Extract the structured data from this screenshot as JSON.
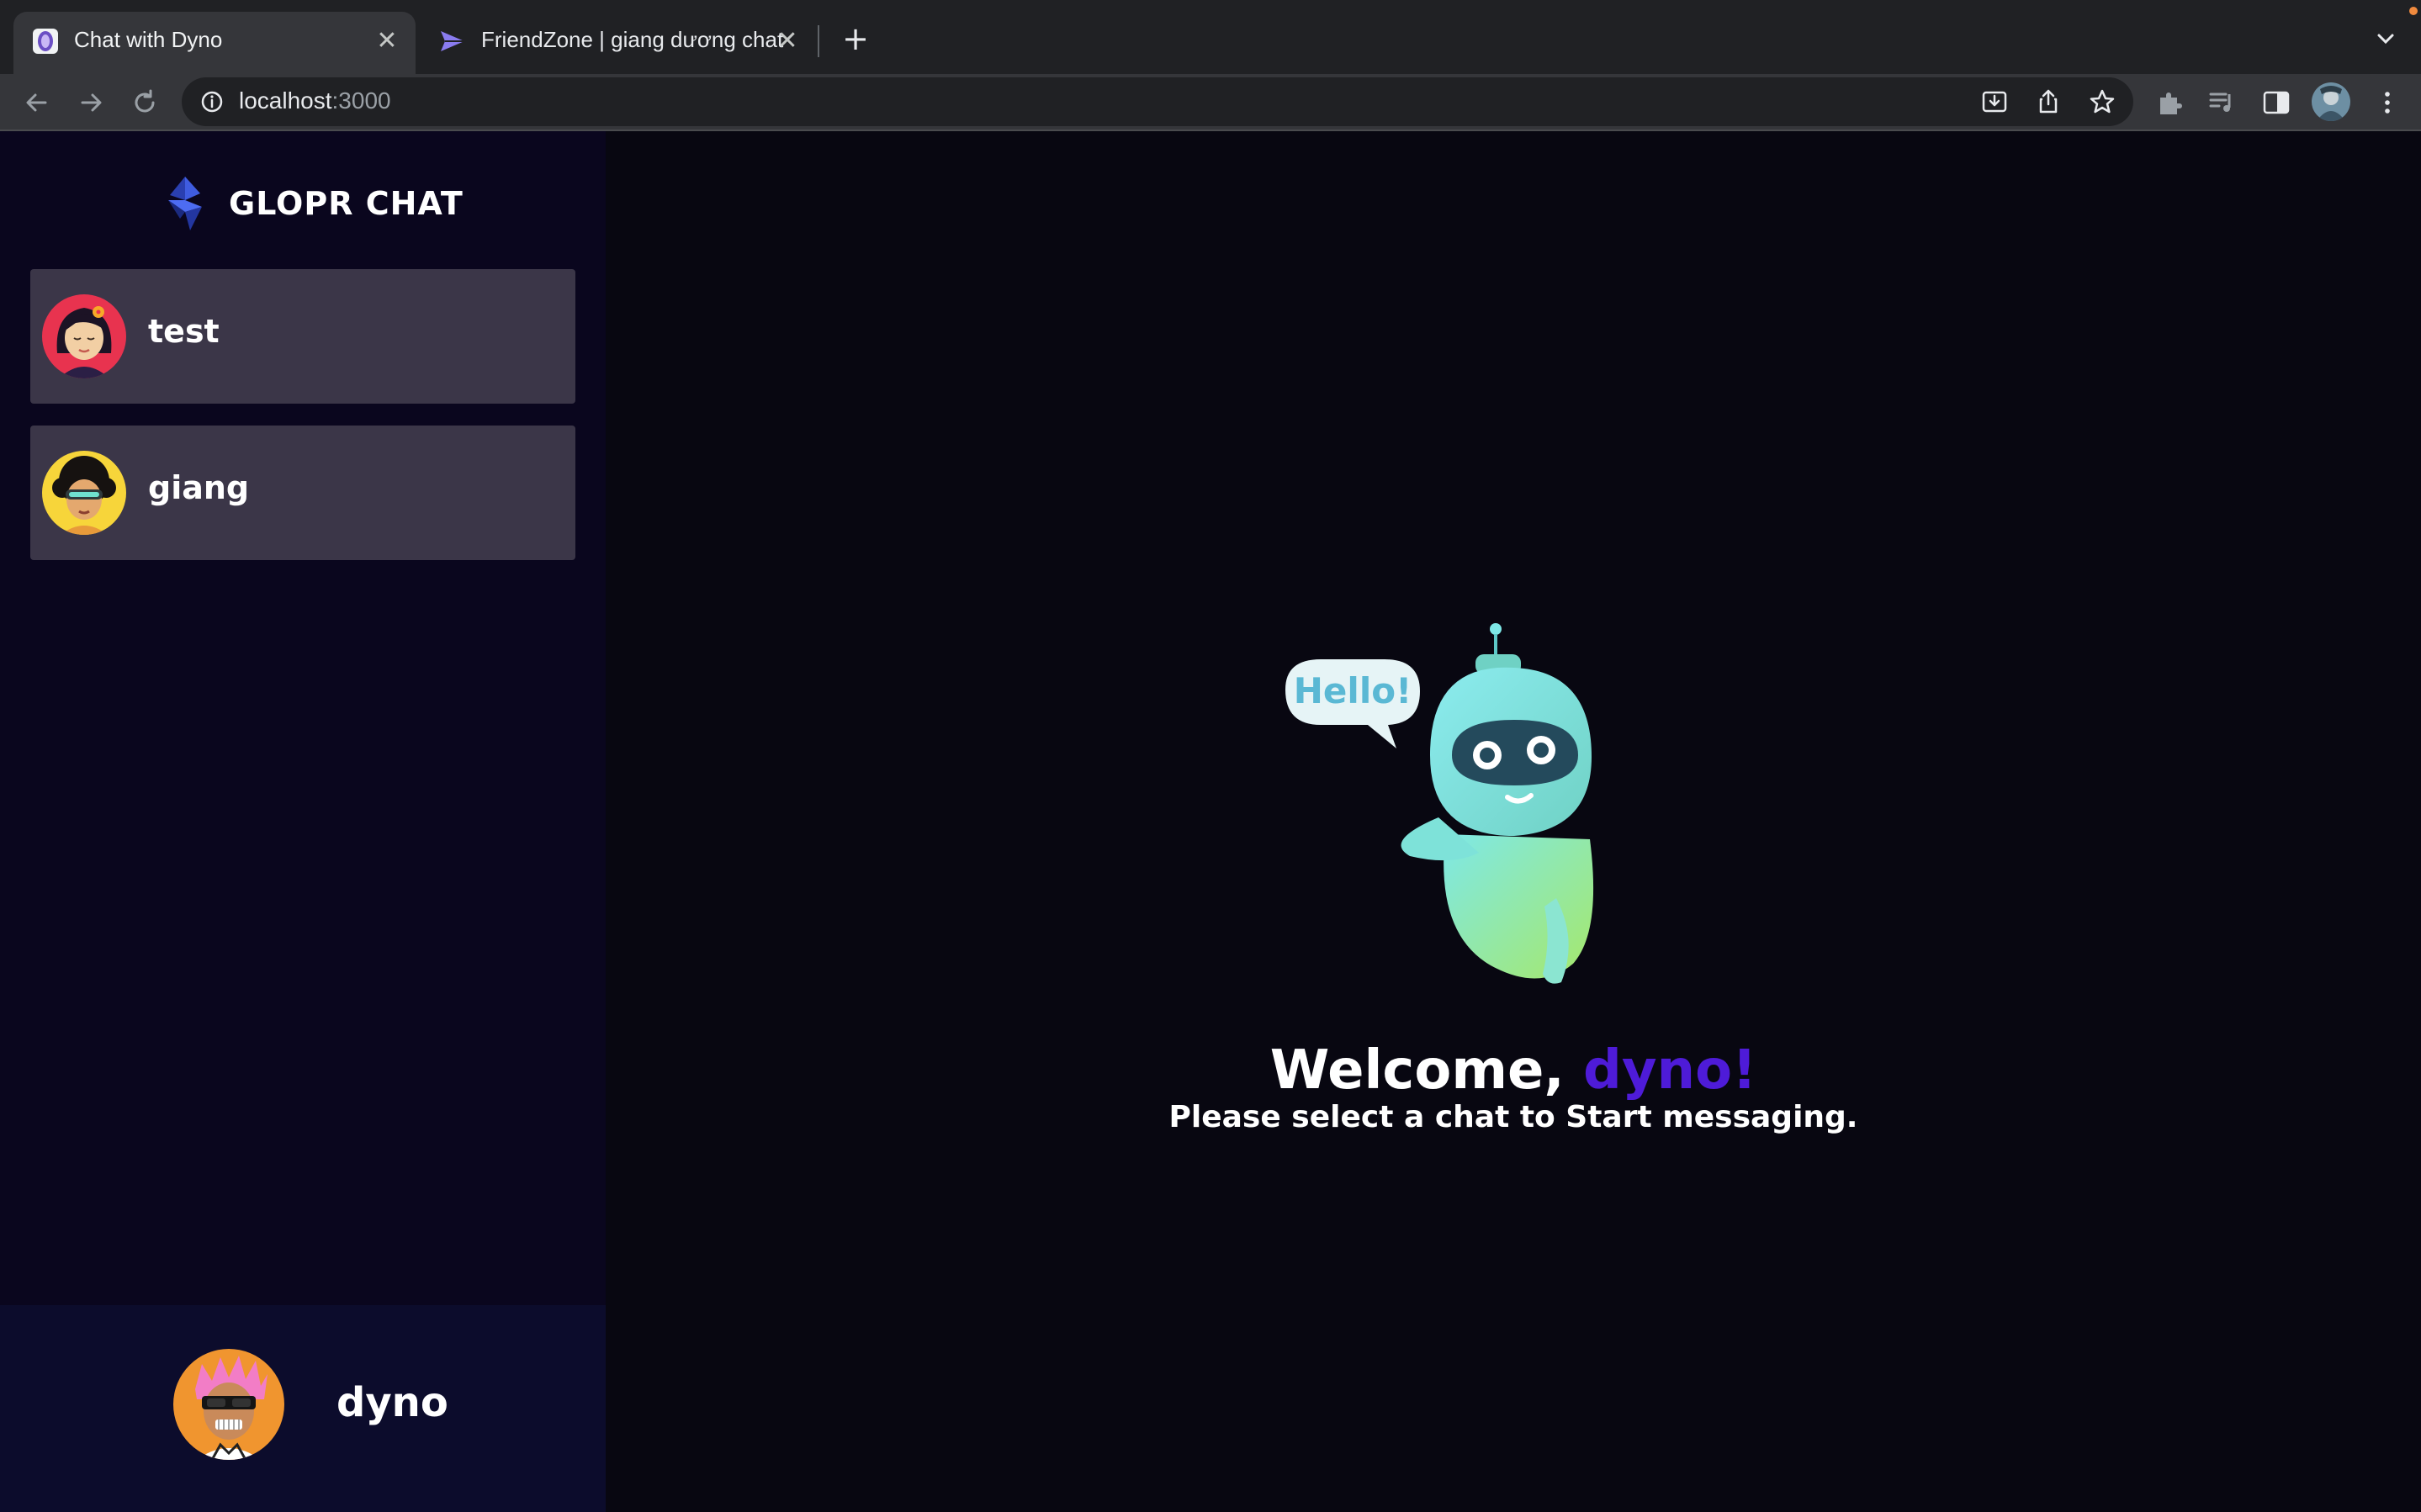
{
  "browser": {
    "tabs": [
      {
        "title": "Chat with Dyno",
        "active": true,
        "icon": "dyno-favicon"
      },
      {
        "title": "FriendZone | giang dương chat",
        "active": false,
        "icon": "paper-plane-favicon"
      }
    ],
    "close_glyph": "✕",
    "new_tab_glyph": "+",
    "address": {
      "host": "localhost",
      "port": ":3000"
    }
  },
  "app": {
    "brand": {
      "name": "GLOPR CHAT",
      "logo": "diamond-logo-icon"
    },
    "contacts": [
      {
        "name": "test",
        "avatar": "woman-avatar"
      },
      {
        "name": "giang",
        "avatar": "curly-hair-avatar"
      }
    ],
    "current_user": {
      "name": "dyno",
      "avatar": "pink-hair-avatar"
    },
    "welcome": {
      "prefix": "Welcome, ",
      "username": "dyno!",
      "subtitle": "Please select a chat to Start messaging.",
      "illustration": "robot-hello-illustration",
      "bubble_text": "Hello!"
    }
  },
  "colors": {
    "sidebar_bg": "#0a061e",
    "contact_bg": "#3b3648",
    "current_user_bg": "#0c0c2c",
    "main_bg": "#080711",
    "accent": "#4e1bd8"
  }
}
